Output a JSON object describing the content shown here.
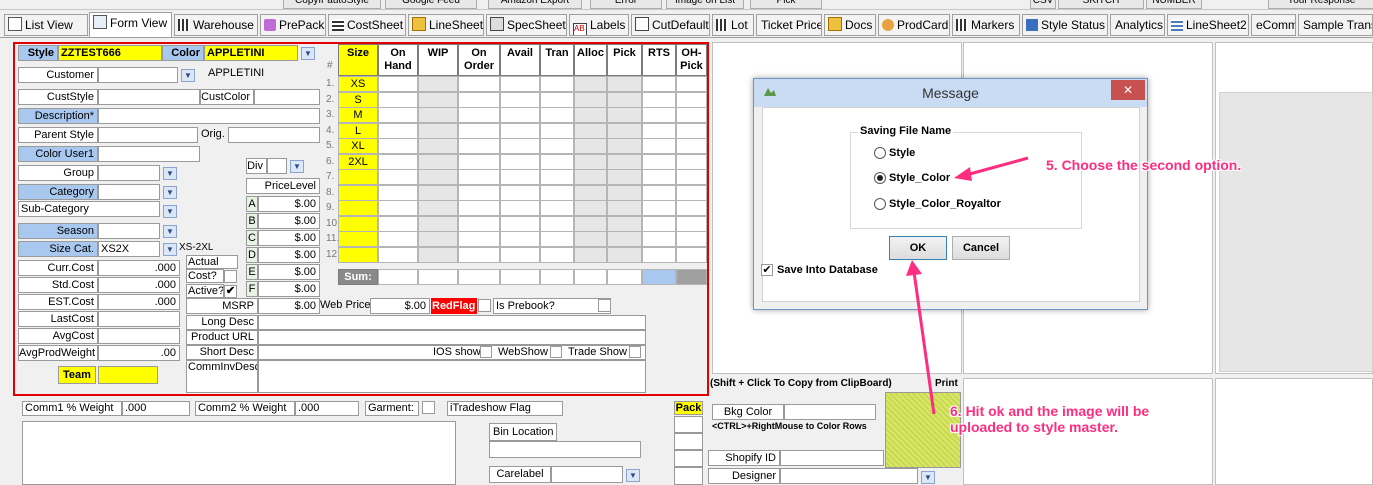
{
  "top_strip": {
    "buttons": [
      "Copyfr autoStyle",
      "Google Feed",
      "Amazon Export",
      "Error",
      "Image on List",
      "Pick",
      "CSV",
      "SKITCH",
      "NUMBER",
      "Your Response"
    ]
  },
  "tabs": [
    "List View",
    "Form View",
    "Warehouse",
    "PrePack",
    "CostSheet",
    "LineSheet",
    "SpecSheet",
    "Labels",
    "CutDefault",
    "Lot",
    "Ticket Price",
    "Docs",
    "ProdCard",
    "Markers",
    "Style Status",
    "Analytics",
    "LineSheet2",
    "eComm",
    "Sample Transa"
  ],
  "form": {
    "style_label": "Style",
    "style_value": "ZZTEST666",
    "color_label": "Color",
    "color_value": "APPLETINI",
    "customer_label": "Customer",
    "customer_desc": "APPLETINI",
    "custstyle_label": "CustStyle",
    "custcolor_label": "CustColor",
    "description_label": "Description*",
    "parent_style_label": "Parent Style",
    "orig_label": "Orig.",
    "color_user1_label": "Color User1",
    "group_label": "Group",
    "category_label": "Category",
    "subcategory_label": "Sub-Category",
    "season_label": "Season",
    "size_cat_label": "Size Cat.",
    "size_cat_value": "XS2X",
    "size_cat_desc": "XS-2XL",
    "div_label": "Div",
    "price_level_label": "PriceLevel",
    "price_levels": [
      {
        "letter": "A",
        "value": "$.00"
      },
      {
        "letter": "B",
        "value": "$.00"
      },
      {
        "letter": "C",
        "value": "$.00"
      },
      {
        "letter": "D",
        "value": "$.00"
      },
      {
        "letter": "E",
        "value": "$.00"
      },
      {
        "letter": "F",
        "value": "$.00"
      }
    ],
    "actual_label": "Actual",
    "cost_q_label": "Cost?",
    "active_label": "Active?",
    "costs": [
      {
        "label": "Curr.Cost",
        "value": ".000"
      },
      {
        "label": "Std.Cost",
        "value": ".000"
      },
      {
        "label": "EST.Cost",
        "value": ".000"
      },
      {
        "label": "LastCost",
        "value": ""
      },
      {
        "label": "AvgCost",
        "value": ""
      },
      {
        "label": "AvgProdWeight",
        "value": ".00"
      }
    ],
    "team_label": "Team",
    "msrp_label": "MSRP",
    "msrp_value": "$.00",
    "webprice_label": "Web Price",
    "webprice_value": "$.00",
    "redflag_label": "RedFlag",
    "prebook_label": "Is Prebook?",
    "longdesc_label": "Long Desc",
    "producturl_label": "Product URL",
    "shortdesc_label": "Short Desc",
    "iosshow_label": "IOS show",
    "webshow_label": "WebShow",
    "tradeshow_label": "Trade Show",
    "comminvdesc_label": "CommInvDesc"
  },
  "grid": {
    "row_hash": "#",
    "headers": [
      "Size",
      "On Hand",
      "WIP",
      "On Order",
      "Avail",
      "Tran",
      "Alloc",
      "Pick",
      "RTS",
      "OH-Pick"
    ],
    "row_numbers": [
      "1.",
      "2.",
      "3.",
      "4.",
      "5.",
      "6.",
      "7.",
      "8.",
      "9.",
      "10.",
      "11.",
      "12."
    ],
    "sizes": [
      "XS",
      "S",
      "M",
      "L",
      "XL",
      "2XL",
      "",
      "",
      "",
      "",
      "",
      ""
    ],
    "sum_label": "Sum:"
  },
  "lower": {
    "comm1_label": "Comm1 % Weight",
    "comm1_value": ".000",
    "comm2_label": "Comm2 % Weight",
    "comm2_value": ".000",
    "garment_label": "Garment:",
    "itradeshow_label": "iTradeshow Flag",
    "bin_location_label": "Bin Location",
    "carelabel_label": "Carelabel",
    "pack_label": "Pack"
  },
  "image_panel": {
    "clipboard_hint": "(Shift + Click To Copy from ClipBoard)",
    "print_label": "Print",
    "bkg_color_label": "Bkg Color",
    "ctrl_hint": "<CTRL>+RightMouse to Color Rows",
    "shopify_label": "Shopify ID",
    "designer_label": "Designer"
  },
  "dialog": {
    "title": "Message",
    "close_glyph": "✕",
    "group_label": "Saving File Name",
    "options": [
      "Style",
      "Style_Color",
      "Style_Color_Royaltor"
    ],
    "selected_option": "Style_Color",
    "ok_label": "OK",
    "cancel_label": "Cancel",
    "save_db_label": "Save Into Database",
    "save_db_checked": true
  },
  "annotations": {
    "step5": "5. Choose the second option.",
    "step6": "6. Hit ok and the image will be uploaded to style master."
  },
  "colors": {
    "accent_blue": "#a9c8f0",
    "highlight_yellow": "#ffff00",
    "annotation_pink": "#ff2d7f",
    "redflag": "#ff0000"
  }
}
